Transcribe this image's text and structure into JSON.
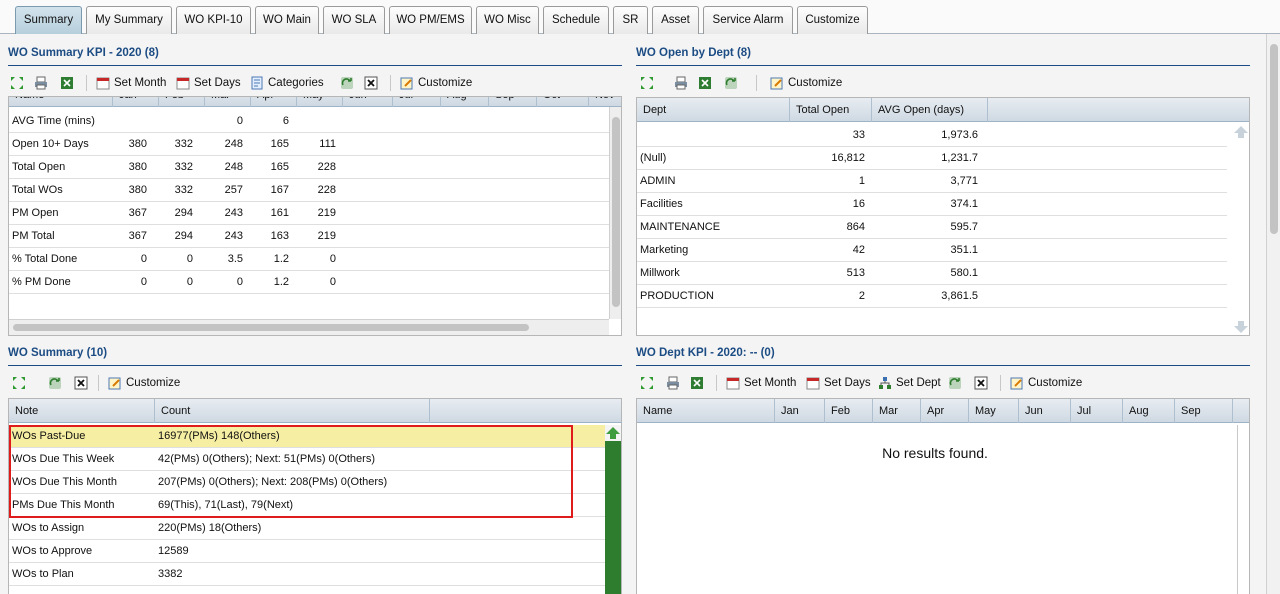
{
  "tabs": [
    {
      "label": "Summary",
      "active": true
    },
    {
      "label": "My Summary"
    },
    {
      "label": "WO KPI-10"
    },
    {
      "label": "WO Main"
    },
    {
      "label": "WO SLA"
    },
    {
      "label": "WO PM/EMS"
    },
    {
      "label": "WO Misc"
    },
    {
      "label": "Schedule"
    },
    {
      "label": "SR"
    },
    {
      "label": "Asset"
    },
    {
      "label": "Service Alarm"
    },
    {
      "label": "Customize"
    }
  ],
  "kpi": {
    "title": "WO Summary KPI - 2020 (8)",
    "toolbar": {
      "set_month": "Set Month",
      "set_days": "Set Days",
      "categories": "Categories",
      "customize": "Customize"
    },
    "columns": [
      "Name",
      "Jan",
      "Feb",
      "Mar",
      "Apr",
      "May",
      "Jun",
      "Jul",
      "Aug",
      "Sep",
      "Oct",
      "Nov"
    ],
    "rows": [
      {
        "name": "AVG Time (mins)",
        "vals": [
          "",
          "",
          "0",
          "6",
          ""
        ]
      },
      {
        "name": "Open 10+ Days",
        "vals": [
          "380",
          "332",
          "248",
          "165",
          "111"
        ]
      },
      {
        "name": "Total Open",
        "vals": [
          "380",
          "332",
          "248",
          "165",
          "228"
        ]
      },
      {
        "name": "Total WOs",
        "vals": [
          "380",
          "332",
          "257",
          "167",
          "228"
        ]
      },
      {
        "name": "PM Open",
        "vals": [
          "367",
          "294",
          "243",
          "161",
          "219"
        ]
      },
      {
        "name": "PM Total",
        "vals": [
          "367",
          "294",
          "243",
          "163",
          "219"
        ]
      },
      {
        "name": "% Total Done",
        "vals": [
          "0",
          "0",
          "3.5",
          "1.2",
          "0"
        ]
      },
      {
        "name": "% PM Done",
        "vals": [
          "0",
          "0",
          "0",
          "1.2",
          "0"
        ]
      }
    ]
  },
  "dept": {
    "title": "WO Open by Dept (8)",
    "toolbar": {
      "customize": "Customize"
    },
    "columns": [
      "Dept",
      "Total Open",
      "AVG Open (days)"
    ],
    "rows": [
      {
        "dept": "",
        "open": "33",
        "avg": "1,973.6"
      },
      {
        "dept": "(Null)",
        "open": "16,812",
        "avg": "1,231.7"
      },
      {
        "dept": "ADMIN",
        "open": "1",
        "avg": "3,771"
      },
      {
        "dept": "Facilities",
        "open": "16",
        "avg": "374.1"
      },
      {
        "dept": "MAINTENANCE",
        "open": "864",
        "avg": "595.7"
      },
      {
        "dept": "Marketing",
        "open": "42",
        "avg": "351.1"
      },
      {
        "dept": "Millwork",
        "open": "513",
        "avg": "580.1"
      },
      {
        "dept": "PRODUCTION",
        "open": "2",
        "avg": "3,861.5"
      }
    ]
  },
  "summary": {
    "title": "WO Summary (10)",
    "toolbar": {
      "customize": "Customize"
    },
    "columns": [
      "Note",
      "Count"
    ],
    "rows": [
      {
        "note": "WOs Past-Due",
        "count": "16977(PMs) 148(Others)",
        "highlight": true
      },
      {
        "note": "WOs Due This Week",
        "count": "42(PMs) 0(Others); Next: 51(PMs) 0(Others)"
      },
      {
        "note": "WOs Due This Month",
        "count": "207(PMs) 0(Others); Next: 208(PMs) 0(Others)"
      },
      {
        "note": "PMs Due This Month",
        "count": "69(This), 71(Last), 79(Next)"
      },
      {
        "note": "WOs to Assign",
        "count": "220(PMs) 18(Others)"
      },
      {
        "note": "WOs to Approve",
        "count": "12589"
      },
      {
        "note": "WOs to Plan",
        "count": "3382"
      }
    ]
  },
  "deptkpi": {
    "title": "WO Dept KPI - 2020: -- (0)",
    "toolbar": {
      "set_month": "Set Month",
      "set_days": "Set Days",
      "set_dept": "Set Dept",
      "customize": "Customize"
    },
    "columns": [
      "Name",
      "Jan",
      "Feb",
      "Mar",
      "Apr",
      "May",
      "Jun",
      "Jul",
      "Aug",
      "Sep"
    ],
    "empty": "No results found."
  },
  "colors": {
    "accent": "#1c4c84",
    "highlight_row": "#f6eea3",
    "annotation_border": "#e01b1b",
    "scroll_green": "#2e7d2e"
  }
}
